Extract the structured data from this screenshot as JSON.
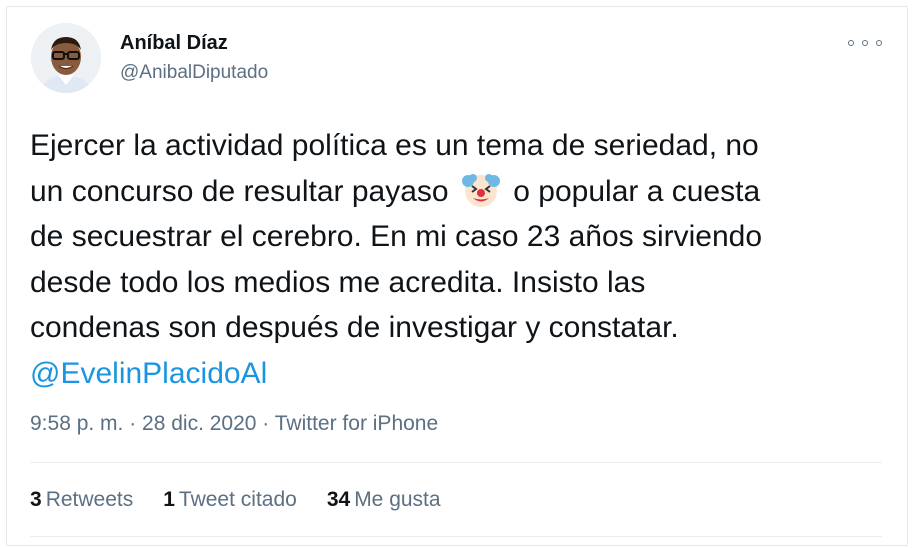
{
  "author": {
    "name": "Aníbal Díaz",
    "handle": "@AnibalDiputado"
  },
  "tweet": {
    "text_line1": "Ejercer la actividad política es un tema de seriedad, no",
    "text_line2_a": "un concurso de resultar payaso",
    "text_line2_b": "o popular a cuesta",
    "text_line3": "de secuestrar el cerebro. En mi caso 23 años sirviendo",
    "text_line4": "desde todo los medios me acredita. Insisto las",
    "text_line5": "condenas son después de investigar y constatar.",
    "mention": "@EvelinPlacidoAl",
    "emoji_icon": "clown-face-icon"
  },
  "meta": "9:58 p. m. · 28 dic. 2020 · Twitter for iPhone",
  "stats": {
    "retweets_count": "3",
    "retweets_label": "Retweets",
    "quotes_count": "1",
    "quotes_label": "Tweet citado",
    "likes_count": "34",
    "likes_label": "Me gusta"
  },
  "colors": {
    "text": "#0f1419",
    "secondary": "#5b7083",
    "link": "#1b95e0",
    "border": "#e1e8ed"
  }
}
